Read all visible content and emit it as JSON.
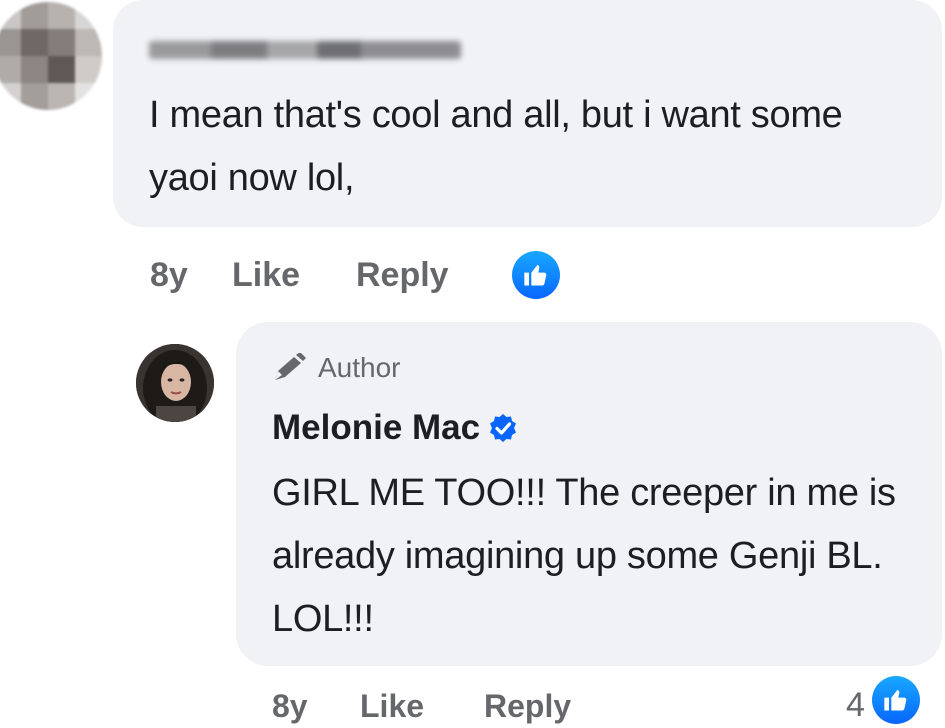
{
  "first_comment": {
    "text": "I mean that's cool and all, but i want some yaoi now lol,",
    "timestamp": "8y",
    "like_label": "Like",
    "reply_label": "Reply",
    "reaction": "like-icon"
  },
  "reply_comment": {
    "badge": "Author",
    "author_name": "Melonie Mac",
    "verified": "verified-badge-icon",
    "text": "GIRL ME TOO!!! The creeper in me is already imagining up some Genji BL. LOL!!!",
    "timestamp": "8y",
    "like_label": "Like",
    "reply_label": "Reply",
    "reaction_count": "4",
    "reaction": "like-icon"
  },
  "colors": {
    "bubble": "#f0f2f5",
    "meta_text": "#65676b",
    "body_text": "#1c1e21",
    "accent_blue": "#0866ff"
  }
}
